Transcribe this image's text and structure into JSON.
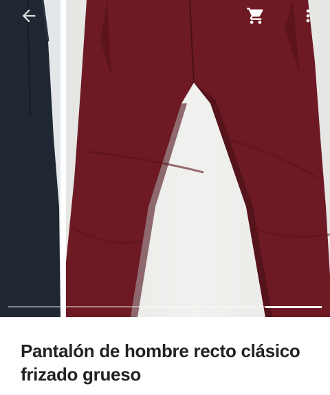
{
  "toolbar": {
    "back_icon": "arrow-left-icon",
    "cart_icon": "shopping-cart-icon",
    "more_icon": "more-vert-icon",
    "icon_color": "#ffffff"
  },
  "gallery": {
    "images": [
      {
        "name": "navy-pants-photo",
        "color": "#1f2733"
      },
      {
        "name": "burgundy-pants-photo",
        "color": "#6e1b24"
      }
    ],
    "scroll_position": 0.85
  },
  "product": {
    "title": "Pantalón de hombre recto clásico frizado grueso"
  }
}
